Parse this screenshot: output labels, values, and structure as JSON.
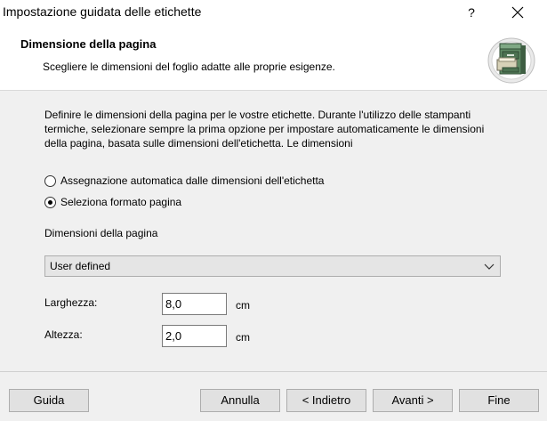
{
  "window": {
    "title": "Impostazione guidata delle etichette",
    "help_label": "?"
  },
  "header": {
    "title": "Dimensione della pagina",
    "subtitle": "Scegliere le dimensioni del foglio adatte alle proprie esigenze.",
    "icon": "file-cabinet-icon"
  },
  "main": {
    "description": "Definire le dimensioni della pagina per le vostre etichette. Durante l'utilizzo delle stampanti termiche, selezionare sempre la prima opzione per impostare automaticamente le dimensioni della pagina, basata sulle dimensioni dell'etichetta. Le dimensioni",
    "options": [
      {
        "label": "Assegnazione automatica dalle dimensioni dell'etichetta",
        "checked": false
      },
      {
        "label": "Seleziona formato pagina",
        "checked": true
      }
    ],
    "page_size_label": "Dimensioni della pagina",
    "page_size_selected": "User defined",
    "width": {
      "label": "Larghezza:",
      "value": "8,0",
      "unit": "cm"
    },
    "height": {
      "label": "Altezza:",
      "value": "2,0",
      "unit": "cm"
    }
  },
  "footer": {
    "help": "Guida",
    "cancel": "Annulla",
    "back": "< Indietro",
    "next": "Avanti >",
    "finish": "Fine"
  }
}
